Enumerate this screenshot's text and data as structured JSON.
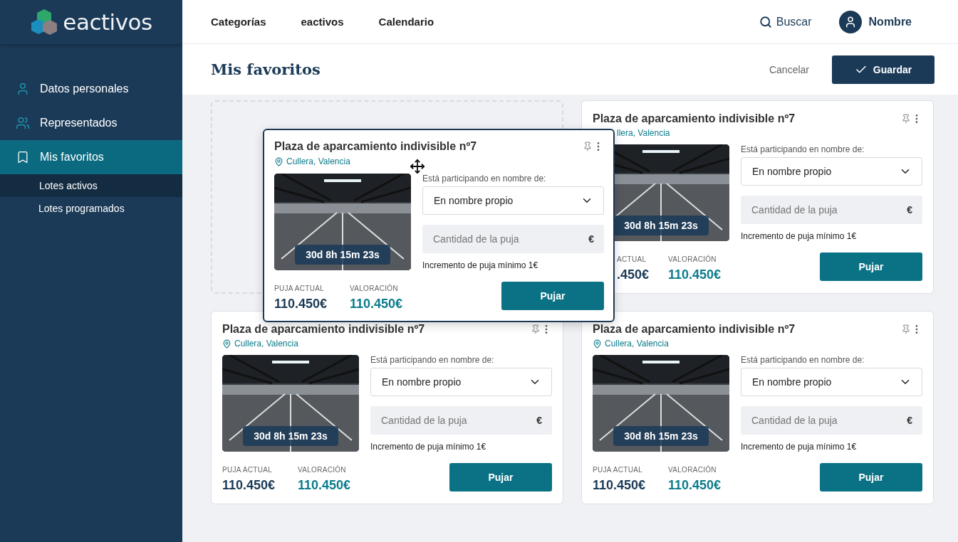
{
  "logo": {
    "text": "eactivos"
  },
  "sidebar": {
    "items": [
      {
        "label": "Datos personales",
        "selected": false
      },
      {
        "label": "Representados",
        "selected": false
      },
      {
        "label": "Mis favoritos",
        "selected": true,
        "children": [
          {
            "label": "Lotes activos",
            "selected": true
          },
          {
            "label": "Lotes programados",
            "selected": false
          }
        ]
      }
    ]
  },
  "nav": [
    {
      "label": "Categorías"
    },
    {
      "label": "eactivos"
    },
    {
      "label": "Calendario"
    }
  ],
  "search": {
    "label": "Buscar"
  },
  "user": {
    "name": "Nombre"
  },
  "page": {
    "title": "Mis favoritos",
    "cancel": "Cancelar",
    "save": "Guardar"
  },
  "slots": [
    {
      "kind": "placeholder"
    },
    {
      "kind": "card",
      "covered": true,
      "title": "Plaza de aparcamiento indivisible nº7",
      "location": "llera, Valencia",
      "timer": "30d 8h 15m 23s",
      "participating_label": "Está participando en nombre de:",
      "select_value": "En nombre propio",
      "bid_placeholder": "Cantidad de la puja",
      "currency": "€",
      "min_increment": "Incremento de puja mínimo 1€",
      "current_label": "ACTUAL",
      "current_value": ".450€",
      "valuation_label": "VALORACIÓN",
      "valuation_value": "110.450€",
      "button": "Pujar"
    },
    {
      "kind": "card",
      "covered": false,
      "title": "Plaza de aparcamiento indivisible nº7",
      "location": "Cullera, Valencia",
      "timer": "30d 8h 15m 23s",
      "participating_label": "Está participando en nombre de:",
      "select_value": "En nombre propio",
      "bid_placeholder": "Cantidad de la puja",
      "currency": "€",
      "min_increment": "Incremento de puja mínimo 1€",
      "current_label": "PUJA ACTUAL",
      "current_value": "110.450€",
      "valuation_label": "VALORACIÓN",
      "valuation_value": "110.450€",
      "button": "Pujar"
    },
    {
      "kind": "card",
      "covered": false,
      "title": "Plaza de aparcamiento indivisible nº7",
      "location": "Cullera, Valencia",
      "timer": "30d 8h 15m 23s",
      "participating_label": "Está participando en nombre de:",
      "select_value": "En nombre propio",
      "bid_placeholder": "Cantidad de la puja",
      "currency": "€",
      "min_increment": "Incremento de puja mínimo 1€",
      "current_label": "PUJA ACTUAL",
      "current_value": "110.450€",
      "valuation_label": "VALORACIÓN",
      "valuation_value": "110.450€",
      "button": "Pujar"
    }
  ],
  "dragged_card": {
    "title": "Plaza de aparcamiento indivisible nº7",
    "location": "Cullera, Valencia",
    "timer": "30d 8h 15m 23s",
    "participating_label": "Está participando en nombre de:",
    "select_value": "En nombre propio",
    "bid_placeholder": "Cantidad de la puja",
    "currency": "€",
    "min_increment": "Incremento de puja mínimo 1€",
    "current_label": "PUJA ACTUAL",
    "current_value": "110.450€",
    "valuation_label": "VALORACIÓN",
    "valuation_value": "110.450€",
    "button": "Pujar"
  }
}
